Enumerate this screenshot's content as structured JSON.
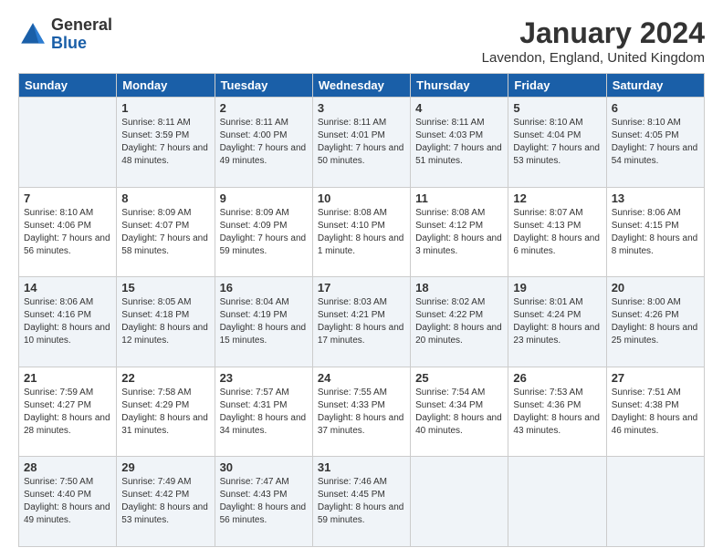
{
  "logo": {
    "general": "General",
    "blue": "Blue"
  },
  "title": "January 2024",
  "location": "Lavendon, England, United Kingdom",
  "headers": [
    "Sunday",
    "Monday",
    "Tuesday",
    "Wednesday",
    "Thursday",
    "Friday",
    "Saturday"
  ],
  "weeks": [
    [
      {
        "day": "",
        "sunrise": "",
        "sunset": "",
        "daylight": ""
      },
      {
        "day": "1",
        "sunrise": "Sunrise: 8:11 AM",
        "sunset": "Sunset: 3:59 PM",
        "daylight": "Daylight: 7 hours and 48 minutes."
      },
      {
        "day": "2",
        "sunrise": "Sunrise: 8:11 AM",
        "sunset": "Sunset: 4:00 PM",
        "daylight": "Daylight: 7 hours and 49 minutes."
      },
      {
        "day": "3",
        "sunrise": "Sunrise: 8:11 AM",
        "sunset": "Sunset: 4:01 PM",
        "daylight": "Daylight: 7 hours and 50 minutes."
      },
      {
        "day": "4",
        "sunrise": "Sunrise: 8:11 AM",
        "sunset": "Sunset: 4:03 PM",
        "daylight": "Daylight: 7 hours and 51 minutes."
      },
      {
        "day": "5",
        "sunrise": "Sunrise: 8:10 AM",
        "sunset": "Sunset: 4:04 PM",
        "daylight": "Daylight: 7 hours and 53 minutes."
      },
      {
        "day": "6",
        "sunrise": "Sunrise: 8:10 AM",
        "sunset": "Sunset: 4:05 PM",
        "daylight": "Daylight: 7 hours and 54 minutes."
      }
    ],
    [
      {
        "day": "7",
        "sunrise": "Sunrise: 8:10 AM",
        "sunset": "Sunset: 4:06 PM",
        "daylight": "Daylight: 7 hours and 56 minutes."
      },
      {
        "day": "8",
        "sunrise": "Sunrise: 8:09 AM",
        "sunset": "Sunset: 4:07 PM",
        "daylight": "Daylight: 7 hours and 58 minutes."
      },
      {
        "day": "9",
        "sunrise": "Sunrise: 8:09 AM",
        "sunset": "Sunset: 4:09 PM",
        "daylight": "Daylight: 7 hours and 59 minutes."
      },
      {
        "day": "10",
        "sunrise": "Sunrise: 8:08 AM",
        "sunset": "Sunset: 4:10 PM",
        "daylight": "Daylight: 8 hours and 1 minute."
      },
      {
        "day": "11",
        "sunrise": "Sunrise: 8:08 AM",
        "sunset": "Sunset: 4:12 PM",
        "daylight": "Daylight: 8 hours and 3 minutes."
      },
      {
        "day": "12",
        "sunrise": "Sunrise: 8:07 AM",
        "sunset": "Sunset: 4:13 PM",
        "daylight": "Daylight: 8 hours and 6 minutes."
      },
      {
        "day": "13",
        "sunrise": "Sunrise: 8:06 AM",
        "sunset": "Sunset: 4:15 PM",
        "daylight": "Daylight: 8 hours and 8 minutes."
      }
    ],
    [
      {
        "day": "14",
        "sunrise": "Sunrise: 8:06 AM",
        "sunset": "Sunset: 4:16 PM",
        "daylight": "Daylight: 8 hours and 10 minutes."
      },
      {
        "day": "15",
        "sunrise": "Sunrise: 8:05 AM",
        "sunset": "Sunset: 4:18 PM",
        "daylight": "Daylight: 8 hours and 12 minutes."
      },
      {
        "day": "16",
        "sunrise": "Sunrise: 8:04 AM",
        "sunset": "Sunset: 4:19 PM",
        "daylight": "Daylight: 8 hours and 15 minutes."
      },
      {
        "day": "17",
        "sunrise": "Sunrise: 8:03 AM",
        "sunset": "Sunset: 4:21 PM",
        "daylight": "Daylight: 8 hours and 17 minutes."
      },
      {
        "day": "18",
        "sunrise": "Sunrise: 8:02 AM",
        "sunset": "Sunset: 4:22 PM",
        "daylight": "Daylight: 8 hours and 20 minutes."
      },
      {
        "day": "19",
        "sunrise": "Sunrise: 8:01 AM",
        "sunset": "Sunset: 4:24 PM",
        "daylight": "Daylight: 8 hours and 23 minutes."
      },
      {
        "day": "20",
        "sunrise": "Sunrise: 8:00 AM",
        "sunset": "Sunset: 4:26 PM",
        "daylight": "Daylight: 8 hours and 25 minutes."
      }
    ],
    [
      {
        "day": "21",
        "sunrise": "Sunrise: 7:59 AM",
        "sunset": "Sunset: 4:27 PM",
        "daylight": "Daylight: 8 hours and 28 minutes."
      },
      {
        "day": "22",
        "sunrise": "Sunrise: 7:58 AM",
        "sunset": "Sunset: 4:29 PM",
        "daylight": "Daylight: 8 hours and 31 minutes."
      },
      {
        "day": "23",
        "sunrise": "Sunrise: 7:57 AM",
        "sunset": "Sunset: 4:31 PM",
        "daylight": "Daylight: 8 hours and 34 minutes."
      },
      {
        "day": "24",
        "sunrise": "Sunrise: 7:55 AM",
        "sunset": "Sunset: 4:33 PM",
        "daylight": "Daylight: 8 hours and 37 minutes."
      },
      {
        "day": "25",
        "sunrise": "Sunrise: 7:54 AM",
        "sunset": "Sunset: 4:34 PM",
        "daylight": "Daylight: 8 hours and 40 minutes."
      },
      {
        "day": "26",
        "sunrise": "Sunrise: 7:53 AM",
        "sunset": "Sunset: 4:36 PM",
        "daylight": "Daylight: 8 hours and 43 minutes."
      },
      {
        "day": "27",
        "sunrise": "Sunrise: 7:51 AM",
        "sunset": "Sunset: 4:38 PM",
        "daylight": "Daylight: 8 hours and 46 minutes."
      }
    ],
    [
      {
        "day": "28",
        "sunrise": "Sunrise: 7:50 AM",
        "sunset": "Sunset: 4:40 PM",
        "daylight": "Daylight: 8 hours and 49 minutes."
      },
      {
        "day": "29",
        "sunrise": "Sunrise: 7:49 AM",
        "sunset": "Sunset: 4:42 PM",
        "daylight": "Daylight: 8 hours and 53 minutes."
      },
      {
        "day": "30",
        "sunrise": "Sunrise: 7:47 AM",
        "sunset": "Sunset: 4:43 PM",
        "daylight": "Daylight: 8 hours and 56 minutes."
      },
      {
        "day": "31",
        "sunrise": "Sunrise: 7:46 AM",
        "sunset": "Sunset: 4:45 PM",
        "daylight": "Daylight: 8 hours and 59 minutes."
      },
      {
        "day": "",
        "sunrise": "",
        "sunset": "",
        "daylight": ""
      },
      {
        "day": "",
        "sunrise": "",
        "sunset": "",
        "daylight": ""
      },
      {
        "day": "",
        "sunrise": "",
        "sunset": "",
        "daylight": ""
      }
    ]
  ]
}
